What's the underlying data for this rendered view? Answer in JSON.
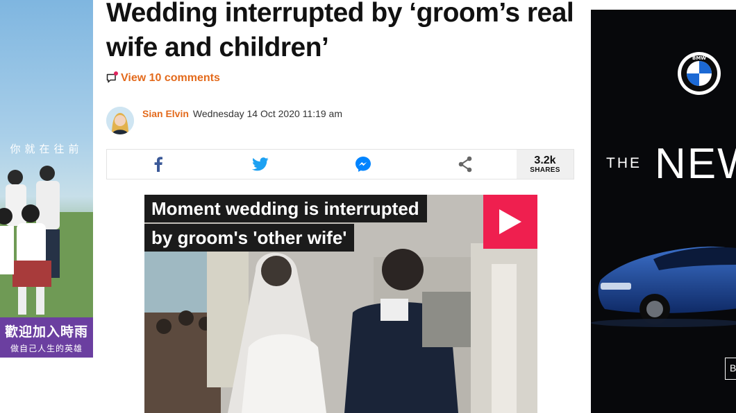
{
  "left_ad": {
    "vertical_text": "你就在往前",
    "banner_line1": "歡迎加入時雨",
    "banner_line2": "做自己人生的英雄"
  },
  "article": {
    "headline": "Wedding interrupted by ‘groom’s real wife and children’",
    "comments_label": "View 10 comments",
    "author": "Sian Elvin",
    "date": "Wednesday 14 Oct 2020 11:19 am"
  },
  "share": {
    "buttons": [
      {
        "name": "facebook",
        "icon": "facebook-icon",
        "color": "#3b5998"
      },
      {
        "name": "twitter",
        "icon": "twitter-icon",
        "color": "#1da1f2"
      },
      {
        "name": "messenger",
        "icon": "messenger-icon",
        "color": "#0084ff"
      },
      {
        "name": "share",
        "icon": "share-icon",
        "color": "#666666"
      }
    ],
    "count": "3.2k",
    "count_label": "SHARES"
  },
  "video": {
    "title_line1": "Moment wedding is interrupted",
    "title_line2": "by groom's 'other wife'",
    "play_color": "#ef1f4f"
  },
  "right_ad": {
    "brand_logo": "bmw-logo",
    "text_the": "THE",
    "text_new": "NEW",
    "cta_text": "B"
  },
  "colors": {
    "accent_orange": "#e36a1c",
    "headline": "#111111"
  }
}
